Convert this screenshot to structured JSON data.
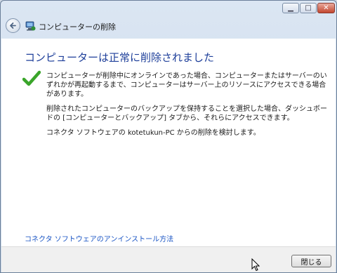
{
  "window": {
    "controls": {
      "minimize": "▁",
      "maximize": "□",
      "close": "✕"
    }
  },
  "nav": {
    "back_icon": "back-arrow-icon",
    "title": "コンピューターの削除"
  },
  "main": {
    "heading": "コンピューターは正常に削除されました",
    "status_icon": "checkmark-icon",
    "paragraphs": [
      "コンピューターが削除中にオンラインであった場合、コンピューターまたはサーバーのいずれかが再起動するまで、コンピューターはサーバー上のリソースにアクセスできる場合があります。",
      "削除されたコンピューターのバックアップを保持することを選択した場合、ダッシュボードの [コンピューターとバックアップ] タブから、それらにアクセスできます。",
      "コネクタ ソフトウェアの kotetukun-PC からの削除を検討します。"
    ],
    "uninstall_link": "コネクタ ソフトウェアのアンインストール方法"
  },
  "footer": {
    "close_label": "閉じる"
  },
  "colors": {
    "heading": "#1e3f9a",
    "link": "#1a55c4",
    "check": "#3aa52a"
  }
}
